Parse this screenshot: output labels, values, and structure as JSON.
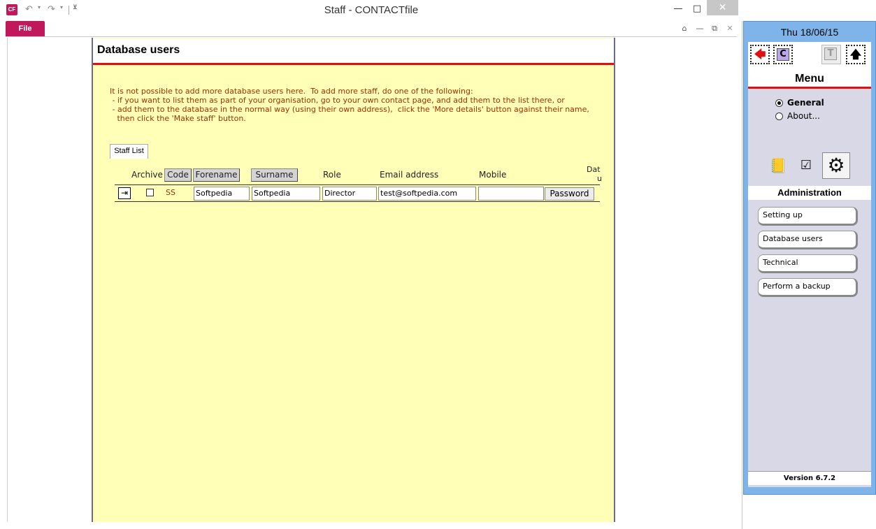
{
  "window": {
    "title": "Staff  -  CONTACTfile",
    "app_icon_text": "CF",
    "file_tab": "File",
    "minimize": "—",
    "maximize": "□",
    "close": "✕",
    "undo": "↶",
    "redo": "↷"
  },
  "ribbon_icons": {
    "home": "⌂",
    "minimize": "—",
    "restore": "⧉",
    "close": "✕"
  },
  "form": {
    "title": "Database users",
    "note_lines": [
      "It is not possible to add more database users here.  To add more staff, do one of the following:",
      " - if you want to list them as part of your organisation, go to your own contact page, and add them to the list there, or",
      " - add them to the database in the normal way (using their own address),  click the 'More details' button against their name,",
      "   then click the 'Make staff' button."
    ],
    "tab_label": "Staff List",
    "columns": {
      "archive": "Archive",
      "code": "Code",
      "forename": "Forename",
      "surname": "Surname",
      "role": "Role",
      "email": "Email address",
      "mobile": "Mobile",
      "date": "Dat",
      "date_cont": "u"
    },
    "rows": [
      {
        "code": "SS",
        "forename": "Softpedia",
        "surname": "Softpedia",
        "role": "Director",
        "email": "test@softpedia.com",
        "mobile": "",
        "password_button": "Password"
      }
    ]
  },
  "side_panel": {
    "date": "Thu 18/06/15",
    "nav_buttons": {
      "back": "🡄",
      "contact": "C",
      "task": "T",
      "up": "🡅"
    },
    "menu_title": "Menu",
    "radio_options": [
      "General",
      "About..."
    ],
    "selected_radio": "General",
    "section_title": "Administration",
    "buttons": [
      "Setting up",
      "Database users",
      "Technical",
      "Perform a backup"
    ],
    "version": "Version 6.7.2",
    "accent_color": "#7eb4ea"
  }
}
